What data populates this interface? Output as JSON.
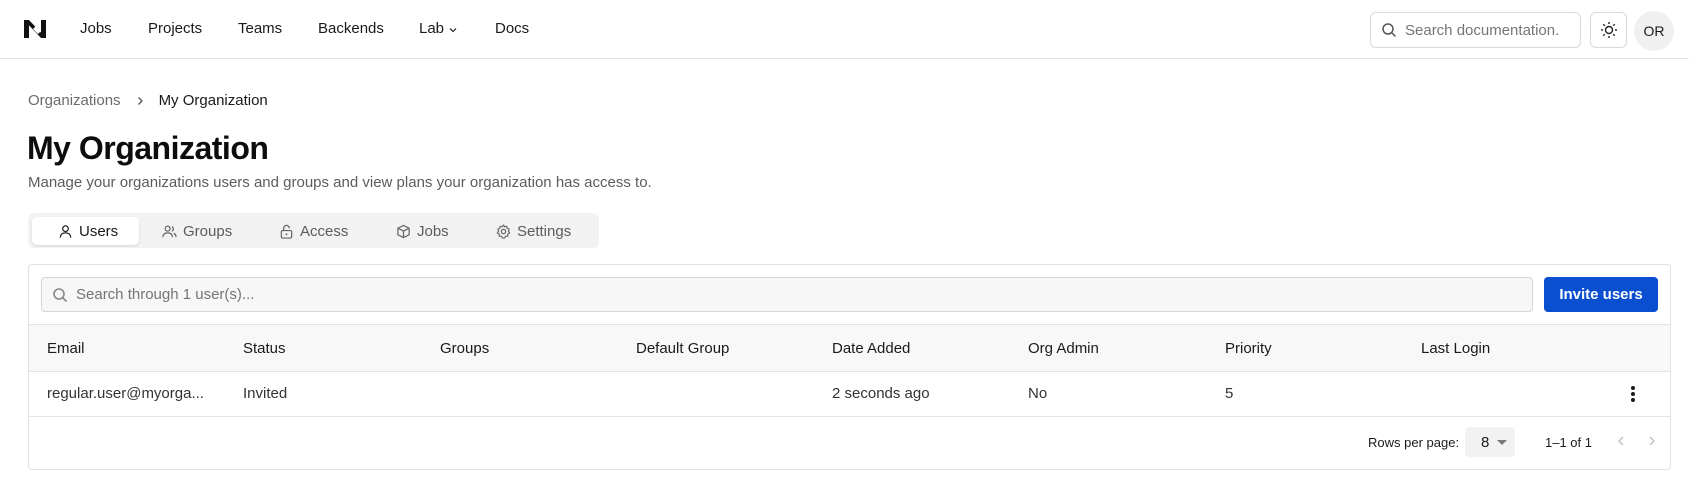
{
  "nav": {
    "items": [
      {
        "label": "Jobs"
      },
      {
        "label": "Projects"
      },
      {
        "label": "Teams"
      },
      {
        "label": "Backends"
      },
      {
        "label": "Lab"
      },
      {
        "label": "Docs"
      }
    ],
    "search_placeholder": "Search documentation.",
    "avatar_initials": "OR"
  },
  "breadcrumb": {
    "parent": "Organizations",
    "current": "My Organization"
  },
  "page": {
    "title": "My Organization",
    "subtitle": "Manage your organizations users and groups and view plans your organization has access to."
  },
  "tabs": [
    {
      "label": "Users",
      "icon": "user-icon",
      "active": true
    },
    {
      "label": "Groups",
      "icon": "users-icon",
      "active": false
    },
    {
      "label": "Access",
      "icon": "unlock-icon",
      "active": false
    },
    {
      "label": "Jobs",
      "icon": "cube-icon",
      "active": false
    },
    {
      "label": "Settings",
      "icon": "gear-icon",
      "active": false
    }
  ],
  "users": {
    "search_placeholder": "Search through 1 user(s)...",
    "invite_label": "Invite users",
    "columns": [
      "Email",
      "Status",
      "Groups",
      "Default Group",
      "Date Added",
      "Org Admin",
      "Priority",
      "Last Login"
    ],
    "rows": [
      {
        "email": "regular.user@myorga...",
        "status": "Invited",
        "groups": "",
        "default_group": "",
        "date_added": "2 seconds ago",
        "org_admin": "No",
        "priority": "5",
        "last_login": ""
      }
    ]
  },
  "pagination": {
    "rows_per_page_label": "Rows per page:",
    "rows_per_page": "8",
    "range": "1–1 of 1"
  },
  "colors": {
    "accent": "#0b4fd1",
    "border": "#e4e4e4"
  }
}
